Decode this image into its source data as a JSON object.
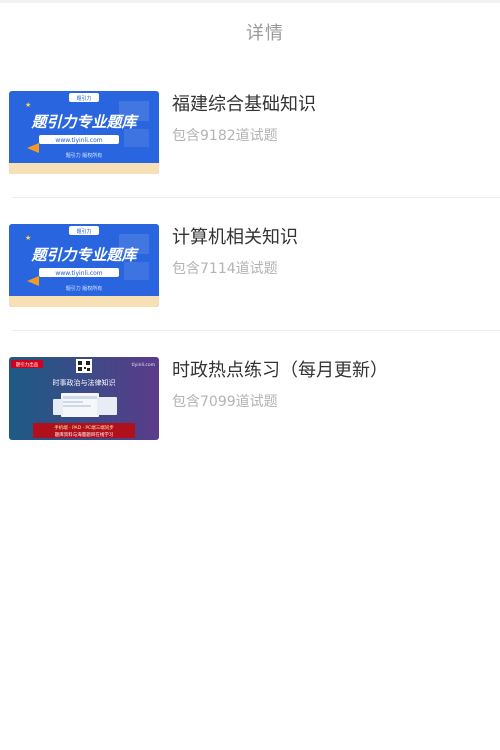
{
  "header": {
    "title": "详情"
  },
  "items": [
    {
      "title": "福建综合基础知识",
      "subtitle": "包含9182道试题",
      "thumb": {
        "headline": "题引力专业题库",
        "url": "www.tiyinli.com",
        "footer": "题引力  版权所有",
        "logo": "题引力"
      }
    },
    {
      "title": "计算机相关知识",
      "subtitle": "包含7114道试题",
      "thumb": {
        "headline": "题引力专业题库",
        "url": "www.tiyinli.com",
        "footer": "题引力  版权所有",
        "logo": "题引力"
      }
    },
    {
      "title": "时政热点练习（每月更新）",
      "subtitle": "包含7099道试题",
      "thumb": {
        "badge": "题引力出品",
        "site": "tiyinli.com",
        "headline": "时事政治与法律知识",
        "line1": "手机端 · PAD · PC端三端同步",
        "line2": "题库资料与海量题目在线学习"
      }
    }
  ],
  "colors": {
    "blue_banner": "#1f5bd8",
    "cream_band": "#f7dfb6",
    "dark_banner_start": "#1d5b85",
    "dark_banner_end": "#5b3b8a",
    "red_badge": "#d0021b"
  }
}
